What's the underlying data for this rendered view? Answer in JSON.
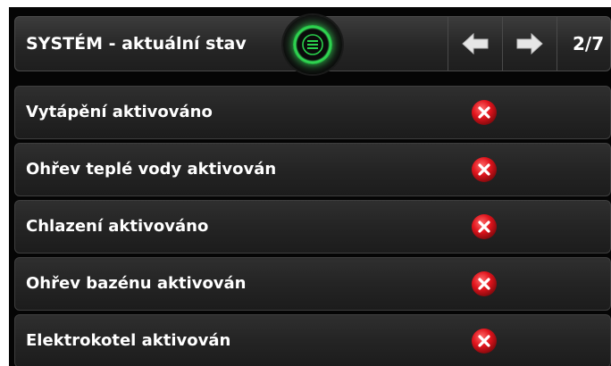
{
  "header": {
    "title": "SYSTÉM - aktuální stav",
    "menu_icon": "list-menu-icon",
    "prev_icon": "arrow-left-icon",
    "next_icon": "arrow-right-icon",
    "page_counter": "2/7"
  },
  "rows": [
    {
      "label": "Vytápění aktivováno",
      "status": "inactive",
      "status_icon": "red-x-icon"
    },
    {
      "label": "Ohřev teplé vody aktivován",
      "status": "inactive",
      "status_icon": "red-x-icon"
    },
    {
      "label": "Chlazení aktivováno",
      "status": "inactive",
      "status_icon": "red-x-icon"
    },
    {
      "label": "Ohřev bazénu aktivován",
      "status": "inactive",
      "status_icon": "red-x-icon"
    },
    {
      "label": "Elektrokotel aktivován",
      "status": "inactive",
      "status_icon": "red-x-icon"
    }
  ],
  "colors": {
    "accent_green": "#34e058",
    "status_red": "#e0141c",
    "background": "#050505"
  }
}
